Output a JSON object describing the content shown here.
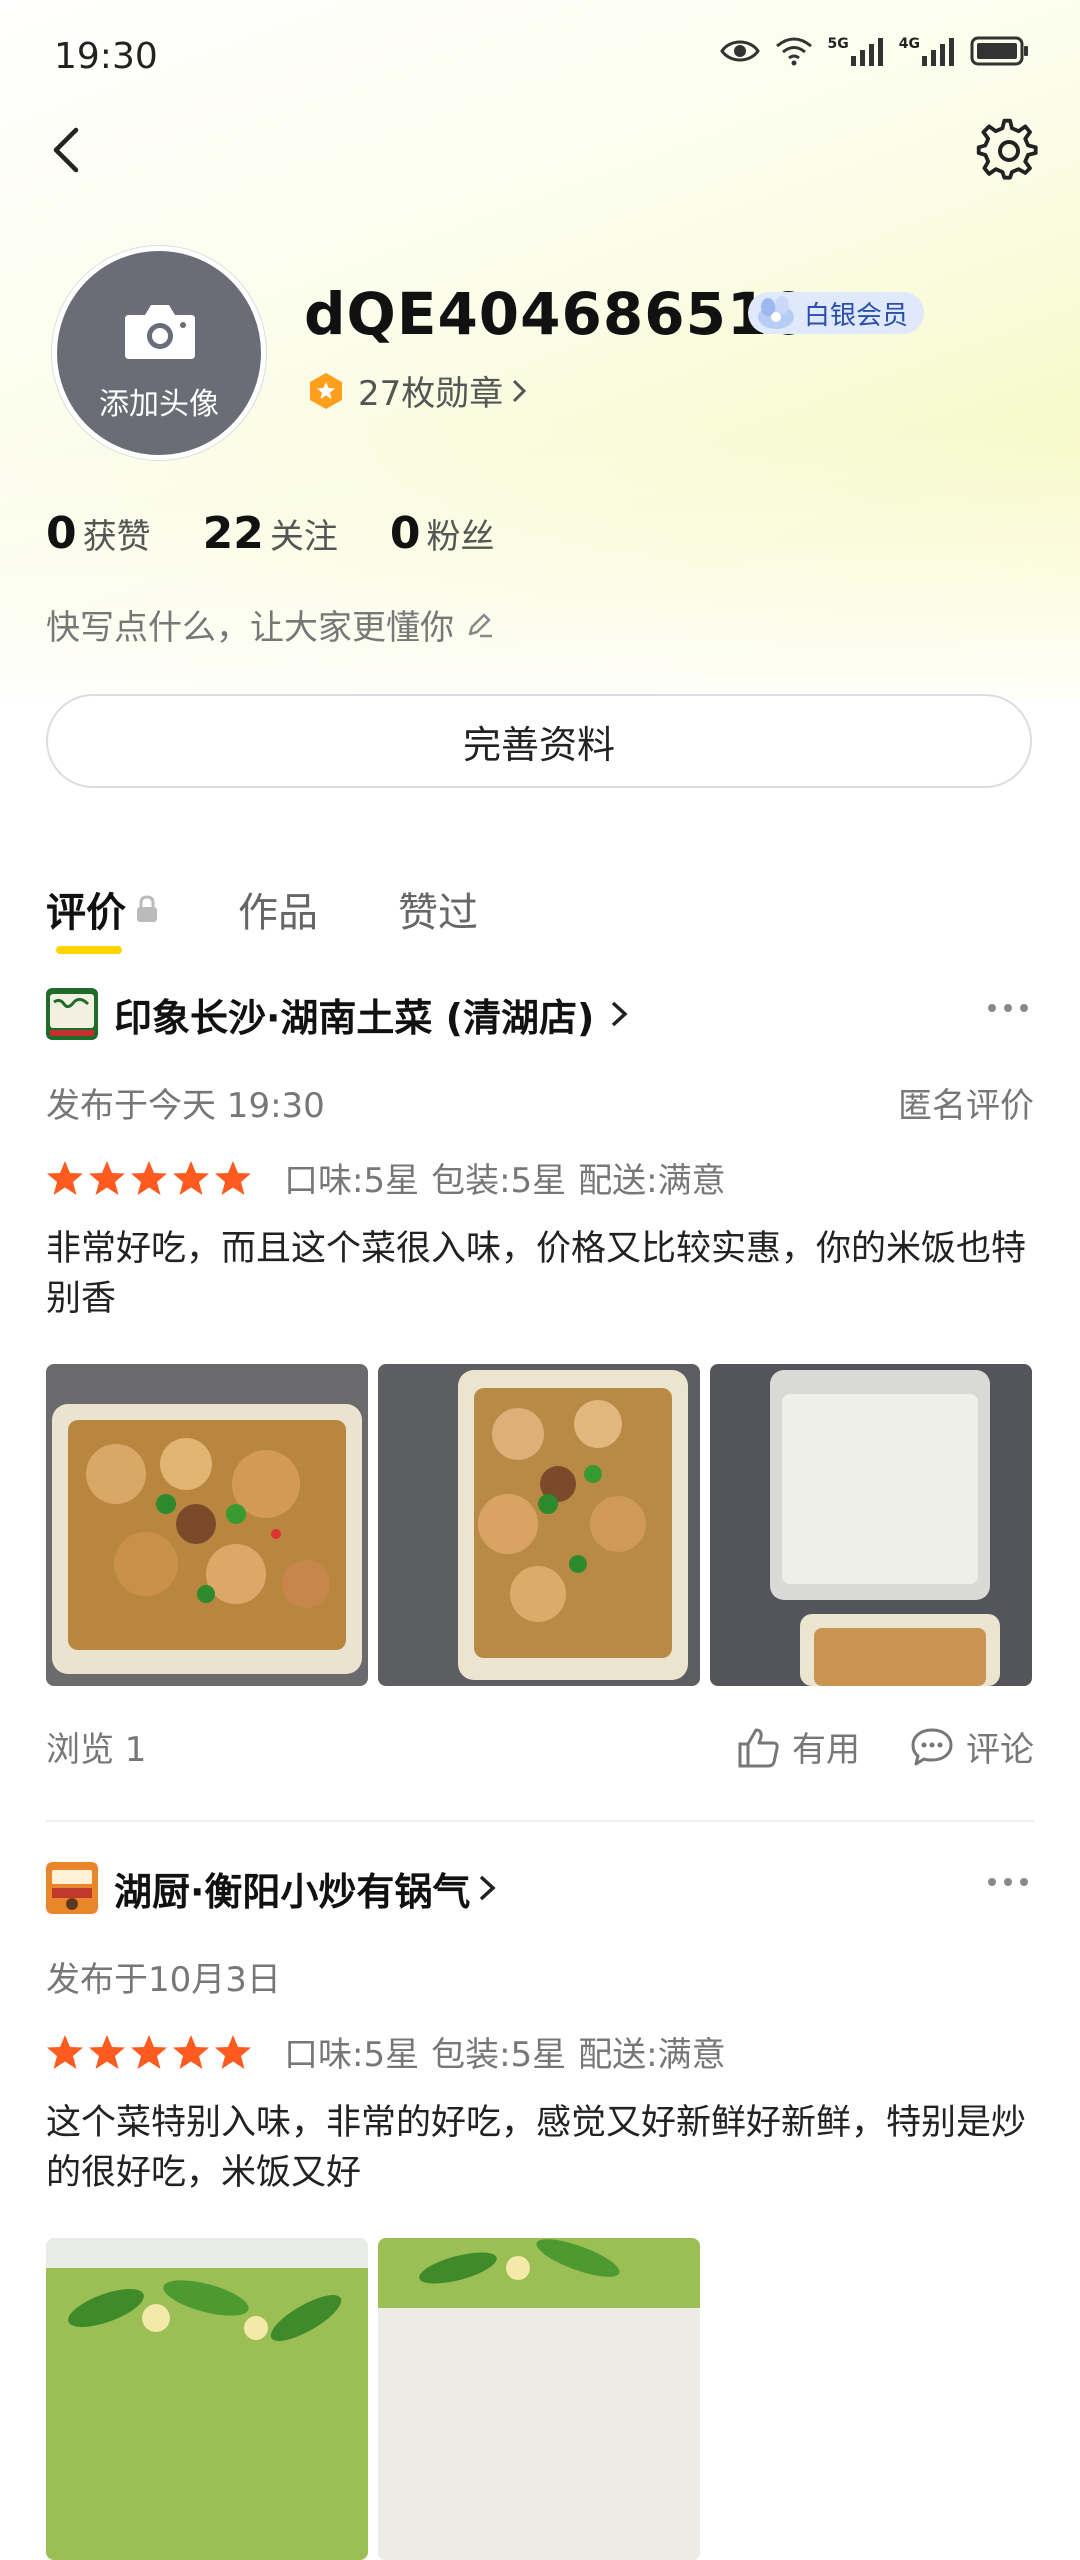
{
  "status_bar": {
    "time": "19:30",
    "net1": "5G",
    "net2": "4G"
  },
  "profile": {
    "avatar_label": "添加头像",
    "username": "dQE404686510",
    "member_badge": "白银会员",
    "medals": "27枚勋章",
    "stats": [
      {
        "num": "0",
        "label": "获赞"
      },
      {
        "num": "22",
        "label": "关注"
      },
      {
        "num": "0",
        "label": "粉丝"
      }
    ],
    "bio_placeholder": "快写点什么，让大家更懂你",
    "complete_button": "完善资料"
  },
  "tabs": [
    {
      "label": "评价",
      "active": true
    },
    {
      "label": "作品",
      "active": false
    },
    {
      "label": "赞过",
      "active": false
    }
  ],
  "reviews": [
    {
      "shop": "印象长沙·湖南土菜 (清湖店)",
      "date": "发布于今天 19:30",
      "anonymous": "匿名评价",
      "stars": 5,
      "ratings": [
        "口味:5星",
        "包装:5星",
        "配送:满意"
      ],
      "text": "非常好吃，而且这个菜很入味，价格又比较实惠，你的米饭也特别香",
      "views": "浏览 1",
      "useful": "有用",
      "comment": "评论"
    },
    {
      "shop": "湖厨·衡阳小炒有锅气",
      "date": "发布于10月3日",
      "stars": 5,
      "ratings": [
        "口味:5星",
        "包装:5星",
        "配送:满意"
      ],
      "text": "这个菜特别入味，非常的好吃，感觉又好新鲜好新鲜，特别是炒的很好吃，米饭又好"
    }
  ],
  "colors": {
    "accent_yellow": "#ffd400",
    "star": "#ff5a1f",
    "member_text": "#2b4fa8"
  }
}
